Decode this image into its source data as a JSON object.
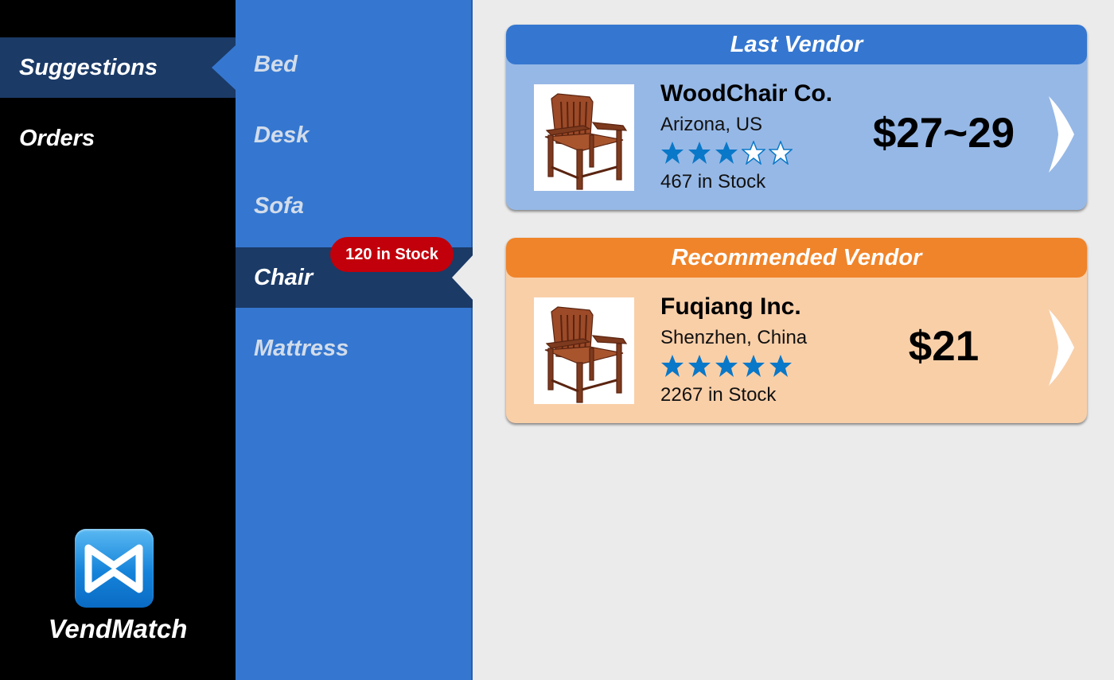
{
  "nav": {
    "items": [
      {
        "label": "Suggestions",
        "active": true
      },
      {
        "label": "Orders",
        "active": false
      }
    ],
    "logo_text": "VendMatch",
    "logo_icon": "vendmatch-logo-icon"
  },
  "categories": {
    "items": [
      {
        "label": "Bed",
        "active": false
      },
      {
        "label": "Desk",
        "active": false
      },
      {
        "label": "Sofa",
        "active": false
      },
      {
        "label": "Chair",
        "active": true
      },
      {
        "label": "Mattress",
        "active": false
      }
    ],
    "stock_badge": "120 in Stock"
  },
  "vendors": {
    "last": {
      "header": "Last Vendor",
      "name": "WoodChair Co.",
      "location": "Arizona, US",
      "rating": 3,
      "rating_max": 5,
      "stock": "467 in Stock",
      "price": "$27~29",
      "image_icon": "chair-image"
    },
    "recommended": {
      "header": "Recommended Vendor",
      "name": "Fuqiang Inc.",
      "location": "Shenzhen, China",
      "rating": 5,
      "rating_max": 5,
      "stock": "2267 in Stock",
      "price": "$21",
      "image_icon": "chair-image"
    }
  },
  "colors": {
    "nav_bg": "#000000",
    "nav_active": "#1b3a66",
    "category_bg": "#3577d0",
    "last_header": "#3577d0",
    "last_body": "#96b8e6",
    "rec_header": "#f0842a",
    "rec_body": "#f9cfa8",
    "badge": "#c2000b",
    "star": "#0a78c8"
  }
}
